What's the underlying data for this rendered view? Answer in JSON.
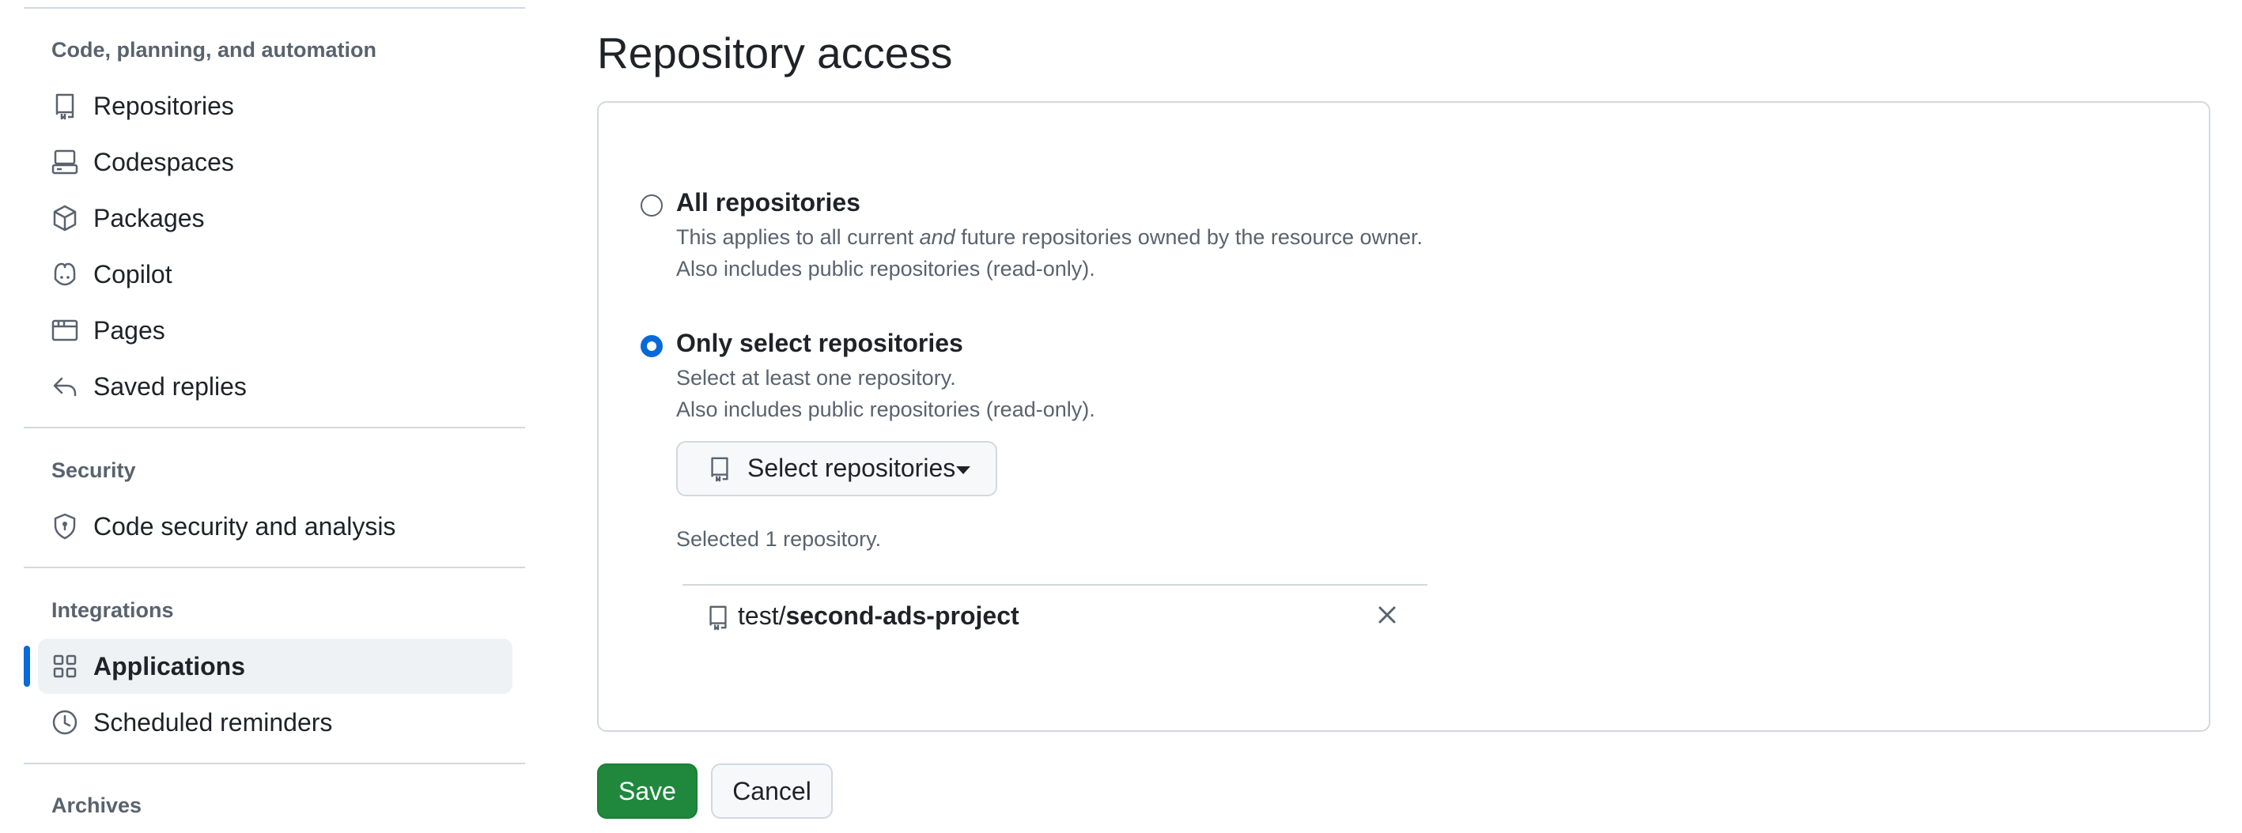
{
  "sidebar": {
    "sections": [
      {
        "title": "Code, planning, and automation"
      },
      {
        "title": "Security"
      },
      {
        "title": "Integrations"
      },
      {
        "title": "Archives"
      }
    ],
    "items": [
      {
        "label": "Repositories",
        "icon": "repo-icon"
      },
      {
        "label": "Codespaces",
        "icon": "codespaces-icon"
      },
      {
        "label": "Packages",
        "icon": "package-icon"
      },
      {
        "label": "Copilot",
        "icon": "copilot-icon"
      },
      {
        "label": "Pages",
        "icon": "browser-icon"
      },
      {
        "label": "Saved replies",
        "icon": "reply-icon"
      },
      {
        "label": "Code security and analysis",
        "icon": "shield-lock-icon"
      },
      {
        "label": "Applications",
        "icon": "apps-icon",
        "active": true
      },
      {
        "label": "Scheduled reminders",
        "icon": "clock-icon"
      }
    ]
  },
  "main": {
    "title": "Repository access",
    "options": [
      {
        "label": "All repositories",
        "desc_prefix": "This applies to all current ",
        "desc_em": "and",
        "desc_suffix": " future repositories owned by the resource owner.",
        "desc2": "Also includes public repositories (read-only).",
        "selected": false
      },
      {
        "label": "Only select repositories",
        "desc1": "Select at least one repository.",
        "desc2": "Also includes public repositories (read-only).",
        "selected": true
      }
    ],
    "select_button": "Select repositories",
    "selected_count": "Selected 1 repository.",
    "repo": {
      "owner": "test/",
      "name": "second-ads-project"
    },
    "save": "Save",
    "cancel": "Cancel"
  },
  "colors": {
    "accent": "#0969da",
    "primary_button": "#1f883d",
    "muted_text": "#59636e",
    "border": "#d1d9e0"
  }
}
